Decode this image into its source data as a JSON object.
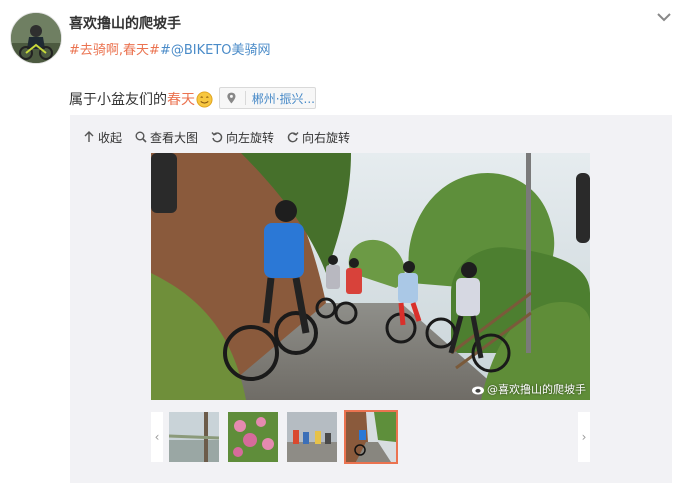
{
  "post": {
    "author": "喜欢撸山的爬坡手",
    "tags": {
      "tag1": "#去骑啊,春天",
      "tag2": "#@BIKETO美骑网"
    },
    "text_before": "属于小盆友们的",
    "text_highlight": "春天",
    "location": "郴州·振兴..."
  },
  "toolbar": {
    "collapse": "收起",
    "view_large": "查看大图",
    "rotate_left": "向左旋转",
    "rotate_right": "向右旋转"
  },
  "photo": {
    "watermark": "@喜欢撸山的爬坡手"
  },
  "colors": {
    "accent": "#eb7350",
    "link_blue": "#4a8bc8",
    "panel_bg": "#f2f2f5"
  },
  "icons": [
    "chevron-down-icon",
    "location-pin-icon",
    "arrow-up-icon",
    "search-icon",
    "rotate-left-icon",
    "rotate-right-icon",
    "weibo-icon",
    "emoji-smile-icon"
  ]
}
